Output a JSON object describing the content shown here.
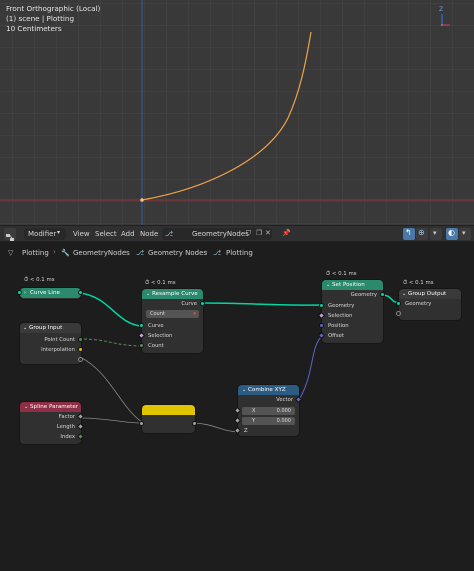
{
  "viewport": {
    "line1": "Front Orthographic (Local)",
    "line2": "(1) scene | Plotting",
    "line3": "10 Centimeters",
    "gizmo_axis_label": "Z"
  },
  "header": {
    "editor_type_icon": "node-editor-icon",
    "modifier": "Modifier",
    "menus": [
      "View",
      "Select",
      "Add",
      "Node"
    ],
    "node_group": "GeometryNodes"
  },
  "breadcrumb": {
    "items": [
      "Plotting",
      "GeometryNodes",
      "Geometry Nodes",
      "Plotting"
    ]
  },
  "nodes": {
    "curve_line": {
      "timing": "< 0.1 ms",
      "title": "Curve Line"
    },
    "group_input": {
      "title": "Group Input",
      "outputs": [
        "Point Count",
        "Interpolation"
      ]
    },
    "resample": {
      "timing": "< 0.1 ms",
      "title": "Resample Curve",
      "output": "Curve",
      "mode": "Count",
      "inputs": [
        "Curve",
        "Selection",
        "Count"
      ]
    },
    "set_position": {
      "timing": "< 0.1 ms",
      "title": "Set Position",
      "output": "Geometry",
      "inputs": [
        "Geometry",
        "Selection",
        "Position",
        "Offset"
      ]
    },
    "group_output": {
      "timing": "< 0.1 ms",
      "title": "Group Output",
      "inputs": [
        "Geometry"
      ]
    },
    "spline_param": {
      "title": "Spline Parameter",
      "outputs": [
        "Factor",
        "Length",
        "Index"
      ]
    },
    "combine_xyz": {
      "title": "Combine XYZ",
      "output": "Vector",
      "x_label": "X",
      "x_value": "0.000",
      "y_label": "Y",
      "y_value": "0.000",
      "z_label": "Z"
    },
    "expression": {
      "title": ""
    }
  },
  "colors": {
    "geometry_socket": "#00d6a3",
    "float_socket": "#a1a1a1",
    "vector_socket": "#6363c7",
    "int_socket": "#598c5c",
    "curve_header": "#2b8a6e",
    "input_header": "#8f2f47",
    "vector_header": "#2a5c84",
    "expression_header": "#e0c400",
    "curve_plot": "#f2a24a"
  }
}
